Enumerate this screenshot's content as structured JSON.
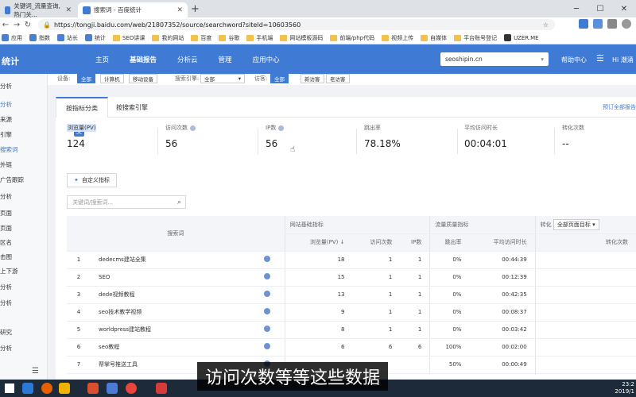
{
  "browser": {
    "tabs": [
      {
        "title": "关键词_流量查询, 热门关..."
      },
      {
        "title": "搜索词 - 百度统计"
      }
    ],
    "url": "https://tongji.baidu.com/web/21807352/source/searchword?siteId=10603560",
    "bookmarks": [
      "应用",
      "指数",
      "站长",
      "统计",
      "SEO讲课",
      "我的网站",
      "百度",
      "谷歌",
      "手机端",
      "网站模板源码",
      "前端/php代码",
      "视频上传",
      "自媒体",
      "平台账号登记",
      "UZER.ME"
    ]
  },
  "app": {
    "logo": "统计",
    "menu": [
      "主页",
      "基础报告",
      "分析云",
      "管理",
      "应用中心"
    ],
    "active_menu": "基础报告",
    "site": "seoshipin.cn",
    "help": "帮助中心",
    "user": "Hi 潮涌"
  },
  "sidebar": [
    "分析",
    "分析",
    "来源",
    "引擎",
    "搜索词",
    "外链",
    "广告跟踪",
    "分析",
    "页面",
    "页面",
    "区名",
    "击图",
    "上下游",
    "分析",
    "分析",
    "研究",
    "分析"
  ],
  "filters": {
    "device_label": "设备:",
    "devices": [
      "全部",
      "计算机",
      "移动设备"
    ],
    "engine_label": "搜索引擎:",
    "engine_value": "全部",
    "visitor_label": "访客:",
    "visitors": [
      "全部",
      "新访客",
      "老访客"
    ]
  },
  "report_tabs": [
    "按指标分类",
    "按搜索引擎"
  ],
  "predefined": "预订全部报告",
  "metrics": [
    {
      "label": "浏览量(PV)",
      "value": "124"
    },
    {
      "label": "访问次数",
      "value": "56"
    },
    {
      "label": "IP数",
      "value": "56"
    },
    {
      "label": "跳出率",
      "value": "78.18%"
    },
    {
      "label": "平均访问时长",
      "value": "00:04:01"
    },
    {
      "label": "转化次数",
      "value": "--"
    }
  ],
  "custom_metric_button": "自定义指标",
  "search_placeholder": "关键词/搜索词...",
  "table": {
    "group_headers": [
      "网站基础指标",
      "流量质量指标",
      "转化"
    ],
    "conversion_select": "全部页面目标",
    "col_keyword": "搜索词",
    "columns": [
      "浏览量(PV)",
      "访问次数",
      "IP数",
      "跳出率",
      "平均访问时长",
      "转化次数"
    ],
    "rows": [
      {
        "n": "1",
        "kw": "dedecms建站全集",
        "pv": "18",
        "visits": "1",
        "ip": "1",
        "bounce": "0%",
        "time": "00:44:39"
      },
      {
        "n": "2",
        "kw": "SEO",
        "pv": "15",
        "visits": "1",
        "ip": "1",
        "bounce": "0%",
        "time": "00:12:39"
      },
      {
        "n": "3",
        "kw": "dede视频教程",
        "pv": "13",
        "visits": "1",
        "ip": "1",
        "bounce": "0%",
        "time": "00:42:35"
      },
      {
        "n": "4",
        "kw": "seo技术教学视频",
        "pv": "9",
        "visits": "1",
        "ip": "1",
        "bounce": "0%",
        "time": "00:08:37"
      },
      {
        "n": "5",
        "kw": "worldpress建站教程",
        "pv": "8",
        "visits": "1",
        "ip": "1",
        "bounce": "0%",
        "time": "00:03:42"
      },
      {
        "n": "6",
        "kw": "seo教程",
        "pv": "6",
        "visits": "6",
        "ip": "6",
        "bounce": "100%",
        "time": "00:02:00"
      },
      {
        "n": "7",
        "kw": "帮掌号推送工具",
        "pv": "",
        "visits": "",
        "ip": "",
        "bounce": "50%",
        "time": "00:00:49"
      }
    ]
  },
  "subtitle": "访问次数等等这些数据",
  "clock": {
    "time": "23:2",
    "date": "2019/1"
  },
  "colors": {
    "brand": "#3f7ad5"
  }
}
